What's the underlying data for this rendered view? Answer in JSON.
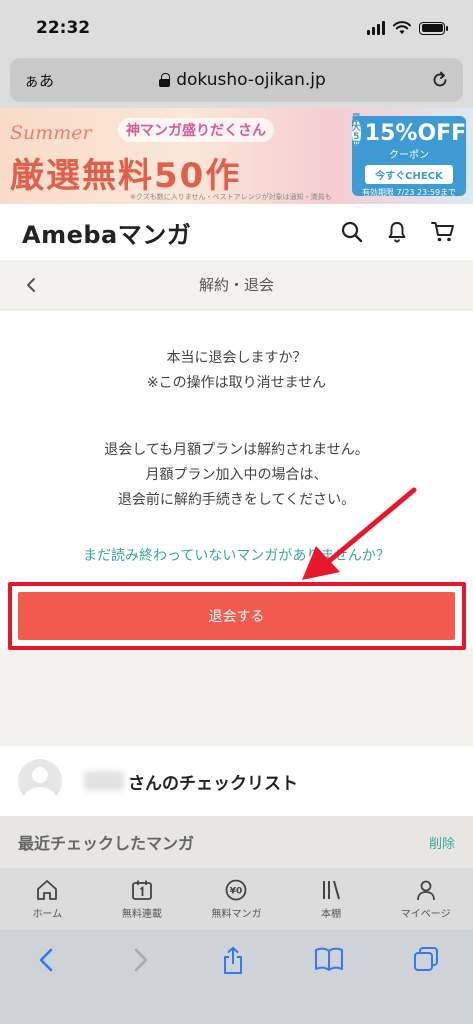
{
  "status_bar": {
    "time": "22:32"
  },
  "url_bar": {
    "aa_label": "ぁあ",
    "domain": "dokusho-ojikan.jp"
  },
  "banner": {
    "summer": "Summer",
    "badge": "神マンガ盛りだくさん",
    "main": "厳選無料50作",
    "note": "※クズも数に入りません・ベストアレンジが対象は通知・満員も",
    "coupon_max": "最大5冊",
    "coupon_percent": "15%OFF",
    "coupon_label": "クーポン",
    "coupon_check": "今すぐCHECK",
    "coupon_expire": "有効期限 7/23 23:59まで"
  },
  "header": {
    "logo": "Amebaマンガ"
  },
  "subheader": {
    "title": "解約・退会"
  },
  "content": {
    "confirm_line1": "本当に退会しますか？",
    "confirm_line2": "※この操作は取り消せません",
    "notice_line1": "退会しても月額プランは解約されません。",
    "notice_line2": "月額プラン加入中の場合は、",
    "notice_line3": "退会前に解約手続きをしてください。",
    "link": "まだ読み終わっていないマンガがありませんか？",
    "withdraw_button": "退会する"
  },
  "checklist": {
    "title": "さんのチェックリスト"
  },
  "recent": {
    "title": "最近チェックしたマンガ",
    "delete": "削除"
  },
  "tabs": [
    {
      "label": "ホーム",
      "icon": "home-icon"
    },
    {
      "label": "無料連載",
      "icon": "calendar-icon"
    },
    {
      "label": "無料マンガ",
      "icon": "free-coin-icon"
    },
    {
      "label": "本棚",
      "icon": "bookshelf-icon"
    },
    {
      "label": "マイページ",
      "icon": "person-icon"
    }
  ],
  "colors": {
    "accent_button": "#f25a50",
    "highlight_border": "#e8172c",
    "link": "#3aa6a0",
    "browser_icons": "#3478f6"
  }
}
